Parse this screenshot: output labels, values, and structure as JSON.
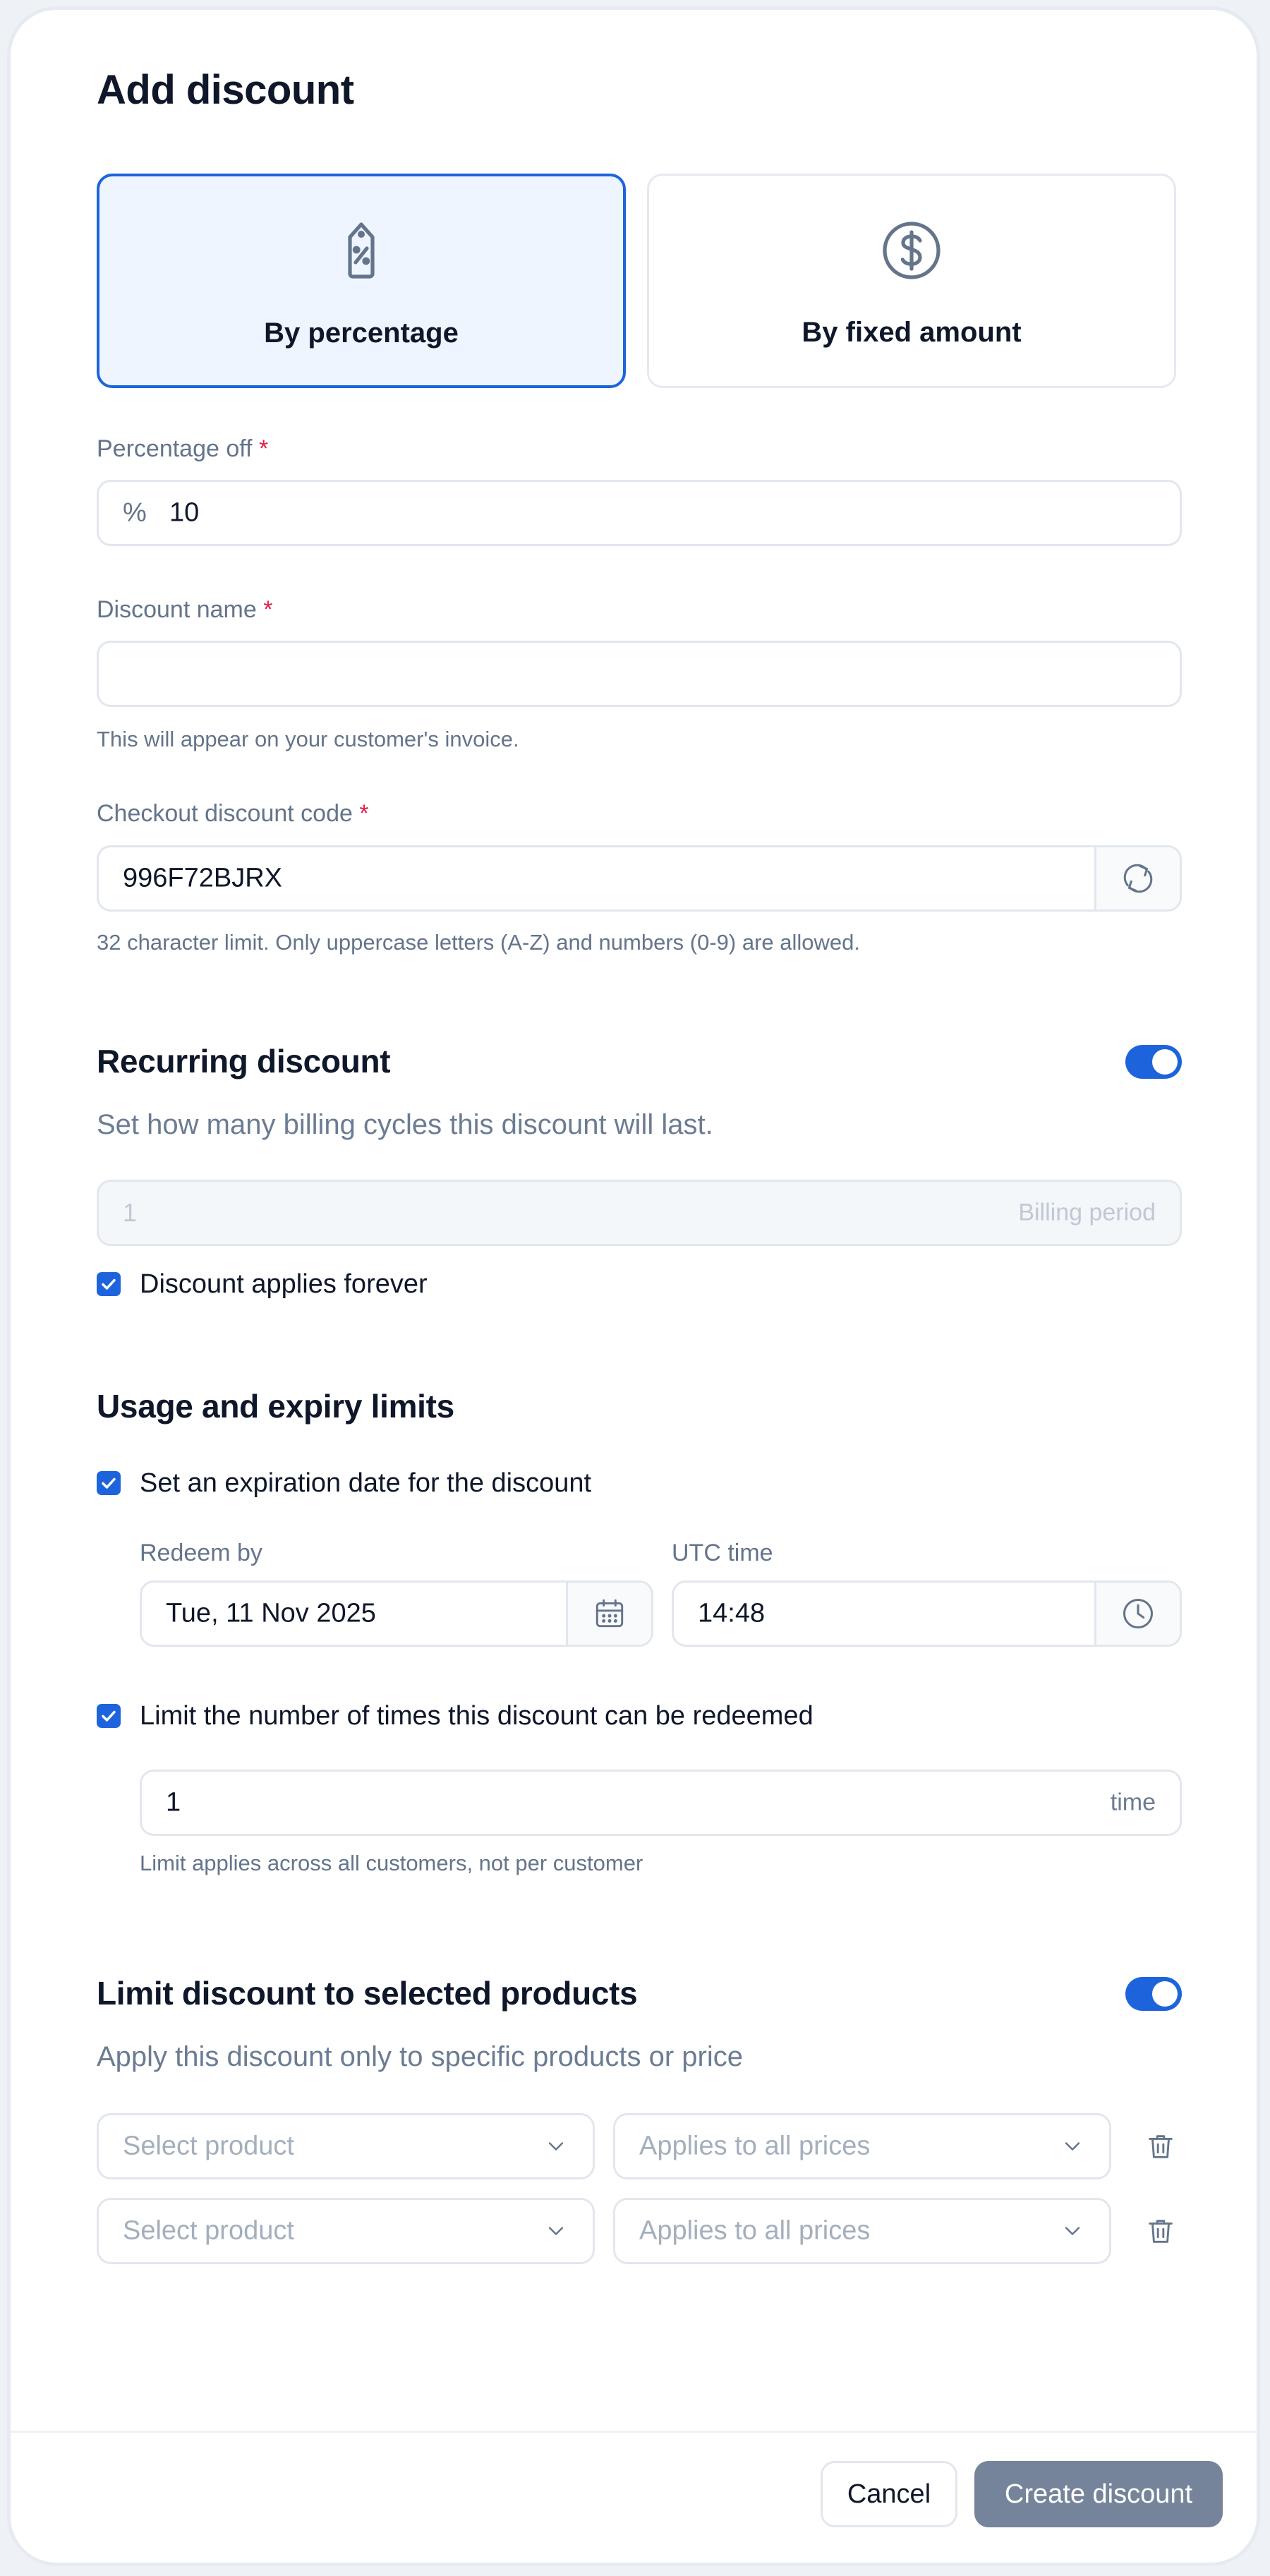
{
  "modal": {
    "title": "Add discount",
    "type_options": [
      {
        "label": "By percentage",
        "icon": "percent-tag-icon",
        "selected": true
      },
      {
        "label": "By fixed  amount",
        "icon": "dollar-circle-icon",
        "selected": false
      }
    ]
  },
  "percentage_off": {
    "label": "Percentage off",
    "required_mark": "*",
    "prefix": "%",
    "value": "10"
  },
  "discount_name": {
    "label": "Discount name",
    "required_mark": "*",
    "value": "",
    "help": "This will appear on your customer's invoice."
  },
  "checkout_code": {
    "label": "Checkout discount code",
    "required_mark": "*",
    "value": "996F72BJRX",
    "refresh_icon": "refresh-icon",
    "help": "32 character limit. Only uppercase letters (A-Z) and numbers (0-9) are allowed."
  },
  "recurring": {
    "title": "Recurring discount",
    "enabled": true,
    "subtitle": "Set how many billing cycles this discount will last.",
    "cycles_value": "1",
    "cycles_suffix": "Billing period",
    "forever_label": "Discount applies forever",
    "forever_checked": true
  },
  "usage": {
    "title": "Usage and expiry limits",
    "expiry_label": "Set an expiration date for the discount",
    "expiry_checked": true,
    "redeem_by_label": "Redeem by",
    "redeem_by_value": "Tue, 11 Nov 2025",
    "time_label": "UTC time",
    "time_value": "14:48",
    "limit_label": "Limit the number of times this discount can be redeemed",
    "limit_checked": true,
    "limit_value": "1",
    "limit_suffix": "time",
    "limit_help": "Limit applies across all customers, not per customer"
  },
  "products": {
    "title": "Limit discount to selected products",
    "enabled": true,
    "subtitle": "Apply this discount only to specific products or price",
    "rows": [
      {
        "product_placeholder": "Select product",
        "price_value": "Applies to all prices"
      },
      {
        "product_placeholder": "Select product",
        "price_value": "Applies to all prices"
      }
    ]
  },
  "footer": {
    "cancel_label": "Cancel",
    "create_label": "Create discount"
  },
  "colors": {
    "accent": "#1d64dc",
    "primary_disabled": "#75849a",
    "required": "#e11d48"
  }
}
